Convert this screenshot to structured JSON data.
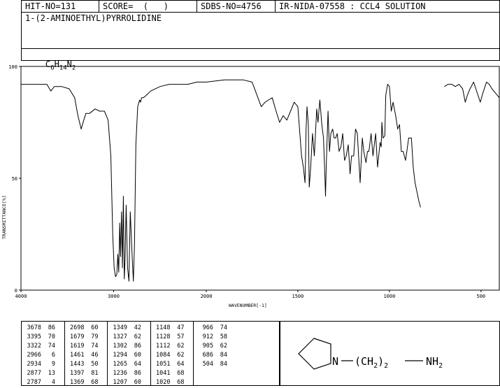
{
  "header": {
    "hit_no": "HIT-NO=131",
    "score": "SCORE=  (   )",
    "sdbs_no": "SDBS-NO=4756",
    "ir_info": "IR-NIDA-07558 : CCL4 SOLUTION"
  },
  "compound": {
    "name": "1-(2-AMINOETHYL)PYRROLIDINE",
    "formula_c": "C",
    "formula_c_n": "6",
    "formula_h": "H",
    "formula_h_n": "14",
    "formula_n": "N",
    "formula_n_n": "2"
  },
  "chart_data": {
    "type": "line",
    "title": "",
    "xlabel": "WAVENUMBER[-1]",
    "ylabel": "TRANSMITTANCE[%]",
    "xlim": [
      4000,
      400
    ],
    "ylim": [
      0,
      100
    ],
    "x_ticks": [
      "4000",
      "3000",
      "2000",
      "1500",
      "1000",
      "500"
    ],
    "y_ticks": [
      "100",
      "50",
      "0"
    ],
    "grid": false,
    "series": [
      {
        "segment": 1,
        "x": [
          4000,
          3900,
          3800,
          3720,
          3678,
          3640,
          3560,
          3480,
          3420,
          3395,
          3380,
          3350,
          3322,
          3300,
          3260,
          3200,
          3150,
          3100,
          3060,
          3030,
          3010,
          2995,
          2980,
          2966,
          2955,
          2945,
          2934,
          2925,
          2915,
          2905,
          2895,
          2885,
          2877,
          2865,
          2850,
          2835,
          2820,
          2800,
          2787,
          2775,
          2760,
          2740,
          2720,
          2710,
          2698,
          2680,
          2650,
          2600,
          2500,
          2400,
          2300,
          2200,
          2100,
          2000,
          1900,
          1800,
          1750,
          1700,
          1679,
          1660,
          1640,
          1619,
          1600,
          1580,
          1560,
          1540,
          1520,
          1500,
          1480,
          1470,
          1461,
          1455,
          1450,
          1443,
          1438,
          1430,
          1420,
          1410,
          1397,
          1390,
          1380,
          1369,
          1360,
          1352,
          1349,
          1345,
          1335,
          1327,
          1320,
          1310,
          1302,
          1294,
          1285,
          1275,
          1265,
          1255,
          1245,
          1236,
          1225,
          1215,
          1207,
          1195,
          1185,
          1175,
          1160,
          1148,
          1140,
          1128,
          1120,
          1112,
          1100,
          1090,
          1084,
          1075,
          1065,
          1051,
          1045,
          1041,
          1035,
          1025,
          1020,
          1010,
          1000,
          990,
          980,
          966,
          955,
          945,
          935,
          925,
          912,
          905,
          895,
          880,
          870,
          860,
          850,
          840,
          830
        ],
        "y": [
          92,
          92,
          92,
          92,
          89,
          91,
          91,
          90,
          86,
          80,
          77,
          72,
          76,
          79,
          79,
          81,
          80,
          80,
          76,
          60,
          25,
          10,
          6,
          7,
          16,
          8,
          30,
          15,
          35,
          10,
          42,
          5,
          13,
          38,
          10,
          4,
          35,
          15,
          4,
          20,
          65,
          82,
          85,
          84,
          86,
          86,
          87,
          89,
          91,
          92,
          92,
          92,
          93,
          93,
          94,
          94,
          93,
          82,
          84,
          85,
          86,
          80,
          75,
          78,
          76,
          80,
          84,
          82,
          60,
          55,
          48,
          72,
          82,
          74,
          46,
          55,
          70,
          60,
          81,
          75,
          85,
          74,
          68,
          50,
          42,
          55,
          80,
          62,
          70,
          72,
          68,
          68,
          70,
          62,
          64,
          70,
          58,
          60,
          65,
          52,
          60,
          60,
          72,
          70,
          48,
          68,
          62,
          57,
          62,
          62,
          70,
          60,
          64,
          70,
          55,
          66,
          64,
          75,
          68,
          69,
          87,
          92,
          91,
          80,
          84,
          78,
          72,
          74,
          62,
          62,
          58,
          62,
          68,
          68,
          55,
          48,
          44,
          40,
          37
        ]
      },
      {
        "segment": 2,
        "x": [
          700,
          680,
          660,
          640,
          620,
          600,
          586,
          575,
          560,
          540,
          520,
          504,
          490,
          470,
          455,
          440,
          420,
          400
        ],
        "y": [
          91,
          92,
          92,
          91,
          92,
          90,
          84,
          87,
          90,
          93,
          88,
          84,
          88,
          93,
          92,
          90,
          88,
          86
        ]
      }
    ]
  },
  "peaks": {
    "columns": [
      [
        [
          "3678",
          "86"
        ],
        [
          "3395",
          "70"
        ],
        [
          "3322",
          "74"
        ],
        [
          "2966",
          "6"
        ],
        [
          "2934",
          "9"
        ],
        [
          "2877",
          "13"
        ],
        [
          "2787",
          "4"
        ]
      ],
      [
        [
          "2698",
          "60"
        ],
        [
          "1679",
          "79"
        ],
        [
          "1619",
          "74"
        ],
        [
          "1461",
          "46"
        ],
        [
          "1443",
          "50"
        ],
        [
          "1397",
          "81"
        ],
        [
          "1369",
          "68"
        ]
      ],
      [
        [
          "1349",
          "42"
        ],
        [
          "1327",
          "62"
        ],
        [
          "1302",
          "86"
        ],
        [
          "1294",
          "60"
        ],
        [
          "1265",
          "64"
        ],
        [
          "1236",
          "86"
        ],
        [
          "1207",
          "60"
        ]
      ],
      [
        [
          "1148",
          "47"
        ],
        [
          "1128",
          "57"
        ],
        [
          "1112",
          "62"
        ],
        [
          "1084",
          "62"
        ],
        [
          "1051",
          "64"
        ],
        [
          "1041",
          "68"
        ],
        [
          "1020",
          "68"
        ]
      ],
      [
        [
          "966",
          "74"
        ],
        [
          "912",
          "58"
        ],
        [
          "905",
          "62"
        ],
        [
          "686",
          "84"
        ],
        [
          "504",
          "84"
        ]
      ]
    ]
  },
  "structure": {
    "n_atom": "N",
    "chain": "(CH",
    "chain_sub": "2",
    "chain_close": ")",
    "chain_count": "2",
    "amine": "NH",
    "amine_sub": "2"
  }
}
